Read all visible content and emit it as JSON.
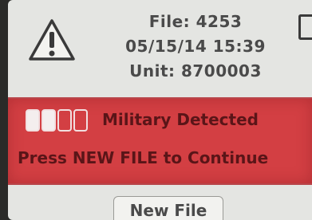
{
  "header": {
    "file_label": "File: 4253",
    "datetime": "05/15/14 15:39",
    "unit_label": "Unit: 8700003"
  },
  "alert": {
    "title": "Military Detected",
    "instruction": "Press NEW FILE to Continue",
    "confidence_level": 2,
    "confidence_max": 4,
    "color": "#d33f43"
  },
  "actions": {
    "new_file_label": "New File"
  },
  "icons": {
    "warning": "warning-triangle-icon",
    "battery": "battery-icon"
  }
}
